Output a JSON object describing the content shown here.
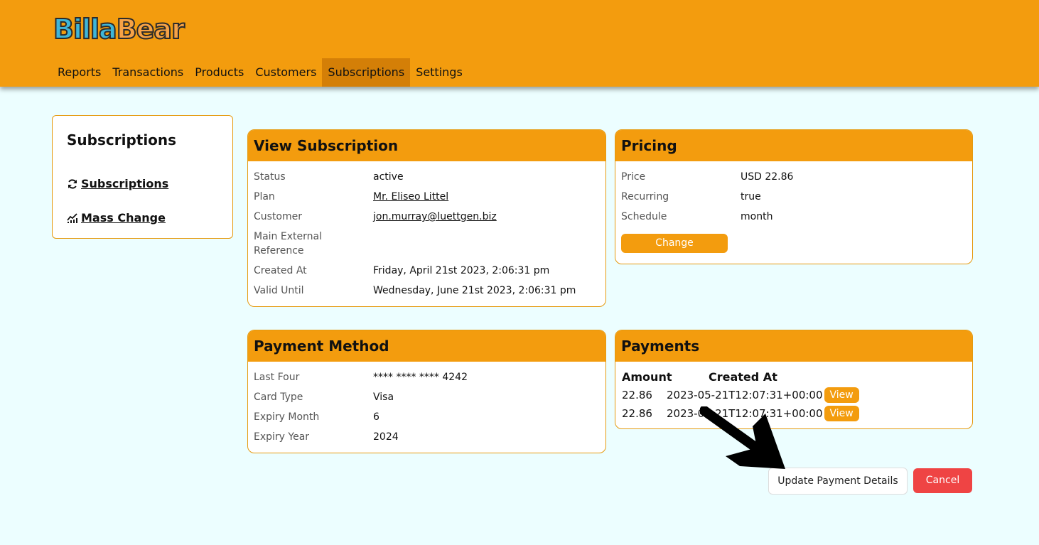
{
  "logo": {
    "part1": "Billa",
    "part2": "Bear"
  },
  "nav": [
    {
      "label": "Reports"
    },
    {
      "label": "Transactions"
    },
    {
      "label": "Products"
    },
    {
      "label": "Customers"
    },
    {
      "label": "Subscriptions",
      "active": true
    },
    {
      "label": "Settings"
    }
  ],
  "sidebar": {
    "title": "Subscriptions",
    "links": [
      {
        "label": "Subscriptions",
        "icon": "refresh-icon"
      },
      {
        "label": "Mass Change",
        "icon": "chart-icon"
      }
    ]
  },
  "view_subscription": {
    "title": "View Subscription",
    "rows": [
      {
        "key": "Status",
        "value": "active"
      },
      {
        "key": "Plan",
        "value": "Mr. Eliseo Littel"
      },
      {
        "key": "Customer",
        "value": "jon.murray@luettgen.biz"
      },
      {
        "key": "Main External Reference",
        "value": ""
      },
      {
        "key": "Created At",
        "value": "Friday, April 21st 2023, 2:06:31 pm"
      },
      {
        "key": "Valid Until",
        "value": "Wednesday, June 21st 2023, 2:06:31 pm"
      }
    ]
  },
  "pricing": {
    "title": "Pricing",
    "rows": [
      {
        "key": "Price",
        "value": "USD 22.86"
      },
      {
        "key": "Recurring",
        "value": "true"
      },
      {
        "key": "Schedule",
        "value": "month"
      }
    ],
    "change_label": "Change"
  },
  "payment_method": {
    "title": "Payment Method",
    "rows": [
      {
        "key": "Last Four",
        "value": "**** **** **** 4242"
      },
      {
        "key": "Card Type",
        "value": "Visa"
      },
      {
        "key": "Expiry Month",
        "value": "6"
      },
      {
        "key": "Expiry Year",
        "value": "2024"
      }
    ]
  },
  "payments": {
    "title": "Payments",
    "headers": {
      "amount": "Amount",
      "created_at": "Created At"
    },
    "rows": [
      {
        "amount": "22.86",
        "created_at": "2023-05-21T12:07:31+00:00",
        "view": "View"
      },
      {
        "amount": "22.86",
        "created_at": "2023-04-21T12:07:31+00:00",
        "view": "View"
      }
    ]
  },
  "actions": {
    "update_payment_label": "Update Payment Details",
    "cancel_label": "Cancel"
  },
  "colors": {
    "header_bg": "#f39c0e",
    "active_nav": "#d47f07",
    "page_bg": "#ecfeff",
    "cancel": "#ef4444",
    "link": "#2563eb"
  }
}
